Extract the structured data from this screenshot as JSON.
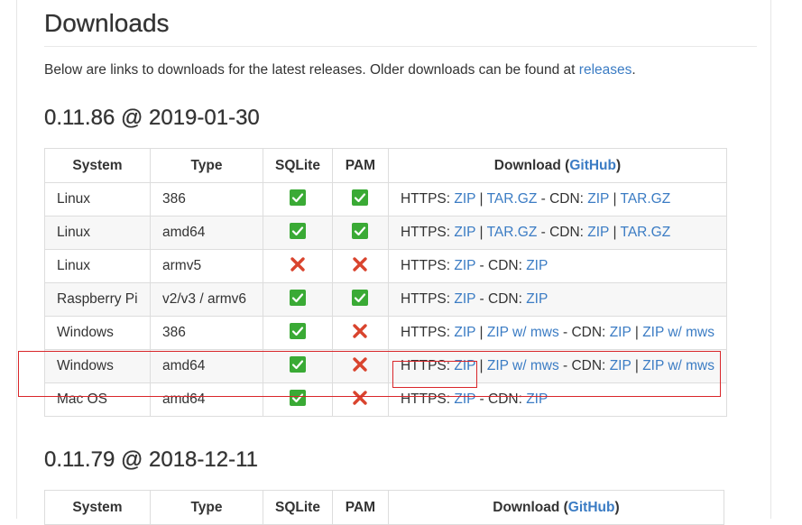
{
  "page": {
    "title": "Downloads",
    "intro_text": "Below are links to downloads for the latest releases. Older downloads can be found at ",
    "intro_link": "releases",
    "intro_end": "."
  },
  "table_headers": {
    "system": "System",
    "type": "Type",
    "sqlite": "SQLite",
    "pam": "PAM",
    "download_prefix": "Download (",
    "download_link": "GitHub",
    "download_suffix": ")"
  },
  "labels": {
    "https": "HTTPS:",
    "cdn": " - CDN:",
    "pipe": "|"
  },
  "releases": [
    {
      "heading": "0.11.86 @ 2019-01-30",
      "rows": [
        {
          "system": "Linux",
          "type": "386",
          "sqlite": "yes",
          "pam": "yes",
          "https": [
            "ZIP",
            "TAR.GZ"
          ],
          "cdn": [
            "ZIP",
            "TAR.GZ"
          ]
        },
        {
          "system": "Linux",
          "type": "amd64",
          "sqlite": "yes",
          "pam": "yes",
          "https": [
            "ZIP",
            "TAR.GZ"
          ],
          "cdn": [
            "ZIP",
            "TAR.GZ"
          ]
        },
        {
          "system": "Linux",
          "type": "armv5",
          "sqlite": "no",
          "pam": "no",
          "https": [
            "ZIP"
          ],
          "cdn": [
            "ZIP"
          ]
        },
        {
          "system": "Raspberry Pi",
          "type": "v2/v3 / armv6",
          "sqlite": "yes",
          "pam": "yes",
          "https": [
            "ZIP"
          ],
          "cdn": [
            "ZIP"
          ]
        },
        {
          "system": "Windows",
          "type": "386",
          "sqlite": "yes",
          "pam": "no",
          "https": [
            "ZIP",
            "ZIP w/ mws"
          ],
          "cdn": [
            "ZIP",
            "ZIP w/ mws"
          ]
        },
        {
          "system": "Windows",
          "type": "amd64",
          "sqlite": "yes",
          "pam": "no",
          "https": [
            "ZIP",
            "ZIP w/ mws"
          ],
          "cdn": [
            "ZIP",
            "ZIP w/ mws"
          ]
        },
        {
          "system": "Mac OS",
          "type": "amd64",
          "sqlite": "yes",
          "pam": "no",
          "https": [
            "ZIP"
          ],
          "cdn": [
            "ZIP"
          ]
        }
      ]
    },
    {
      "heading": "0.11.79 @ 2018-12-11",
      "rows": []
    }
  ],
  "colors": {
    "link": "#3b7cc4",
    "check": "#3aaa35",
    "cross": "#d9442e",
    "highlight": "#d9262a"
  },
  "icons": {
    "yes": "check-icon",
    "no": "cross-icon"
  }
}
